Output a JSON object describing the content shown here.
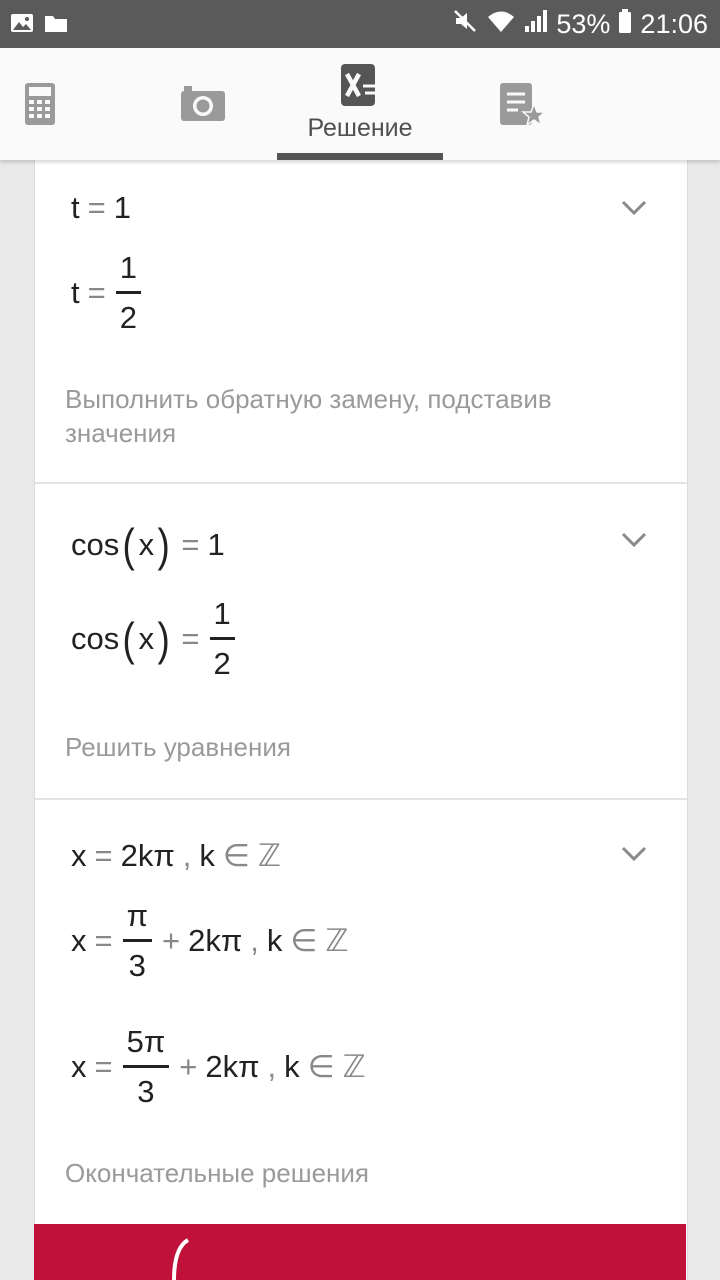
{
  "status_bar": {
    "battery_percent": "53%",
    "time": "21:06",
    "left_icons": [
      "image-notification-icon",
      "folder-notification-icon"
    ],
    "right_icons": [
      "mute-icon",
      "wifi-icon",
      "signal-icon",
      "battery-icon"
    ]
  },
  "toolbar": {
    "items": [
      {
        "name": "calculator",
        "icon": "calculator-icon"
      },
      {
        "name": "camera",
        "icon": "camera-icon"
      },
      {
        "name": "solution",
        "icon": "solution-x-icon",
        "label": "Решение",
        "active": true
      },
      {
        "name": "favorites",
        "icon": "notebook-star-icon"
      }
    ]
  },
  "steps": [
    {
      "lines": [
        {
          "lhs": "t",
          "eq": "=",
          "rhs": "1"
        },
        {
          "lhs": "t",
          "eq": "=",
          "num": "1",
          "den": "2"
        }
      ],
      "hint": "Выполнить обратную замену, подставив значения"
    },
    {
      "lines": [
        {
          "func": "cos",
          "arg": "x",
          "eq": "=",
          "rhs": "1"
        },
        {
          "func": "cos",
          "arg": "x",
          "eq": "=",
          "num": "1",
          "den": "2"
        }
      ],
      "hint": "Решить уравнения"
    },
    {
      "lines": [
        {
          "lhs": "x",
          "eq": "=",
          "rhs": "2kπ",
          "sep": ",",
          "k": "k",
          "in": "∈",
          "set": "ℤ"
        },
        {
          "lhs": "x",
          "eq": "=",
          "num": "π",
          "den": "3",
          "plus": "+",
          "rhs": "2kπ",
          "sep": ",",
          "k": "k",
          "in": "∈",
          "set": "ℤ"
        },
        {
          "lhs": "x",
          "eq": "=",
          "num": "5π",
          "den": "3",
          "plus": "+",
          "rhs": "2kπ",
          "sep": ",",
          "k": "k",
          "in": "∈",
          "set": "ℤ"
        }
      ],
      "hint": "Окончательные решения"
    }
  ],
  "colors": {
    "status_bar": "#5a5a5a",
    "toolbar": "#fafafa",
    "accent_bar": "#c0113b",
    "background": "#e9e9e9"
  }
}
